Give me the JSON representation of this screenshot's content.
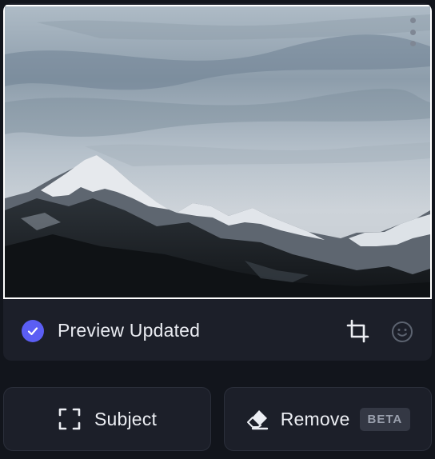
{
  "preview": {
    "status_text": "Preview Updated",
    "status_icon": "check-circle-icon",
    "menu_icon": "more-vertical-icon",
    "image_alt": "mountain-landscape"
  },
  "toolbar": {
    "crop_icon": "crop-icon",
    "emoji_icon": "smiley-icon"
  },
  "actions": {
    "subject_label": "Subject",
    "subject_icon": "focus-frame-icon",
    "remove_label": "Remove",
    "remove_icon": "eraser-icon",
    "remove_badge": "BETA"
  },
  "colors": {
    "accent": "#5b5ef4",
    "background": "#12151c",
    "card": "#1c1f29"
  }
}
